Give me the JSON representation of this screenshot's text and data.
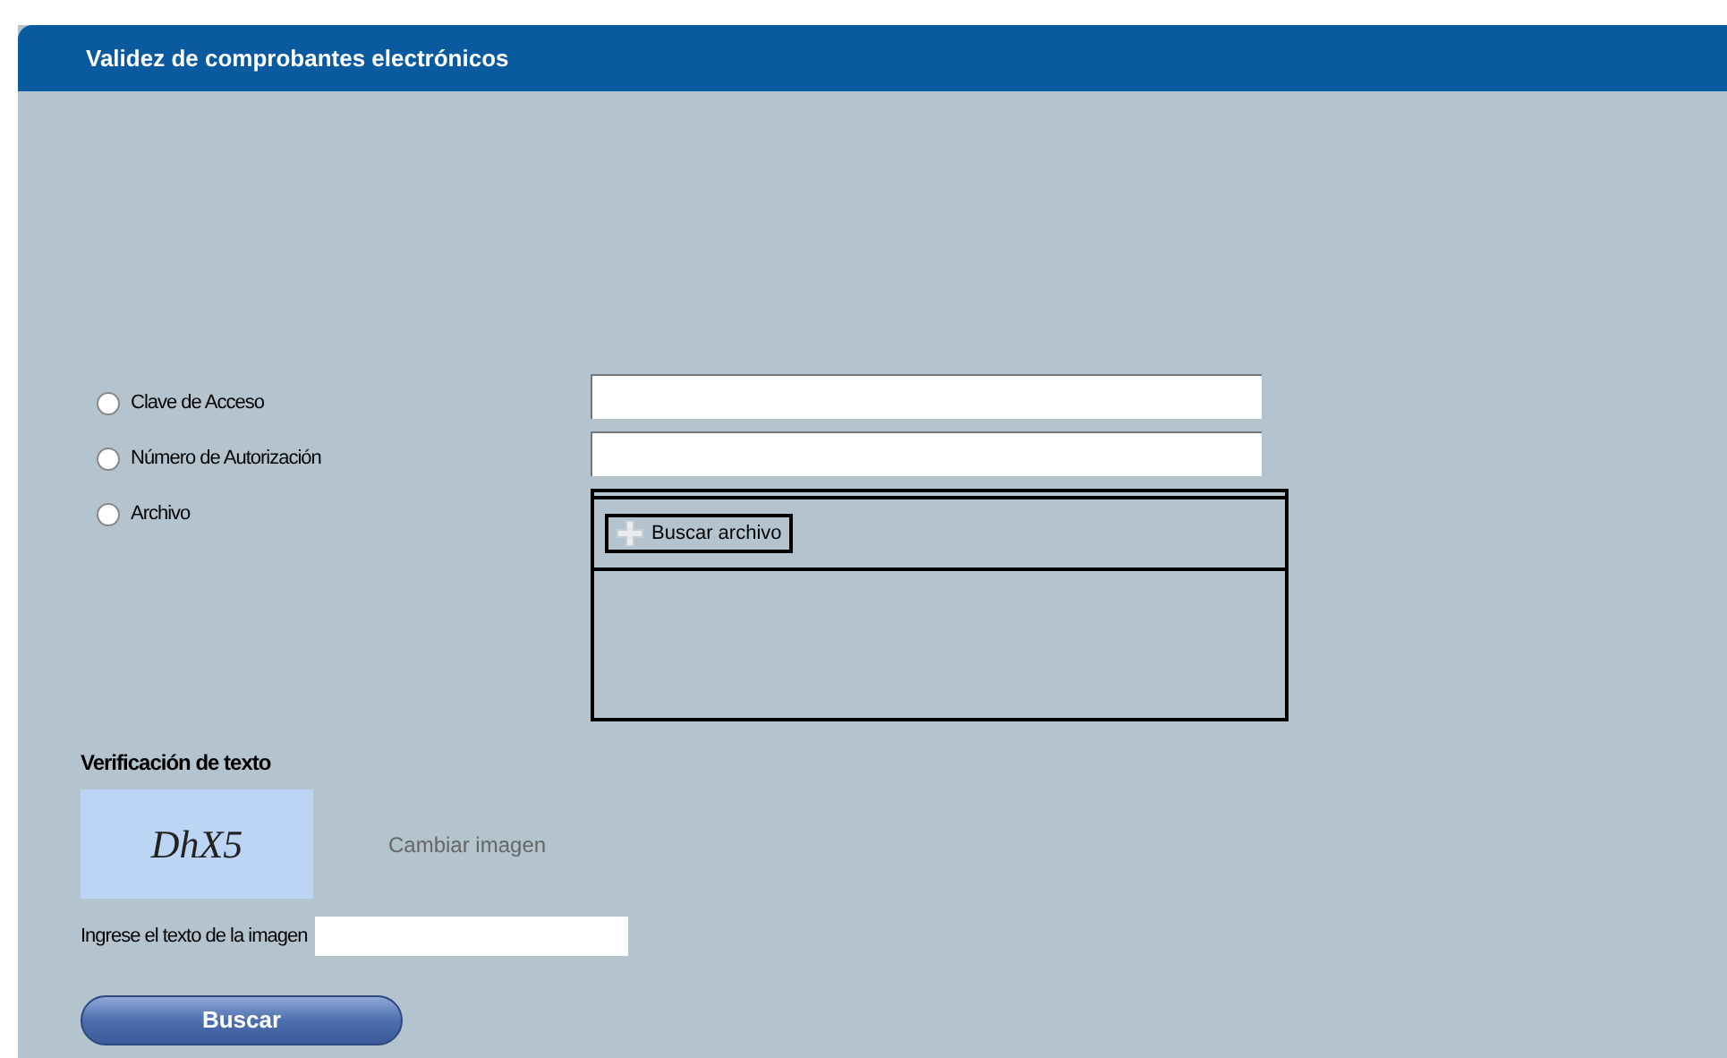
{
  "header": {
    "title": "Validez de comprobantes electrónicos"
  },
  "options": [
    {
      "label": "Clave de Acceso",
      "selected": false,
      "kind": "text"
    },
    {
      "label": "Número de Autorización",
      "selected": false,
      "kind": "text"
    },
    {
      "label": "Archivo",
      "selected": false,
      "kind": "file"
    }
  ],
  "file_button": "Buscar archivo",
  "verification": {
    "title": "Verificación de texto",
    "captcha": "DhX5",
    "change_link": "Cambiar imagen",
    "input_label": "Ingrese el texto de la imagen"
  },
  "submit": "Buscar"
}
